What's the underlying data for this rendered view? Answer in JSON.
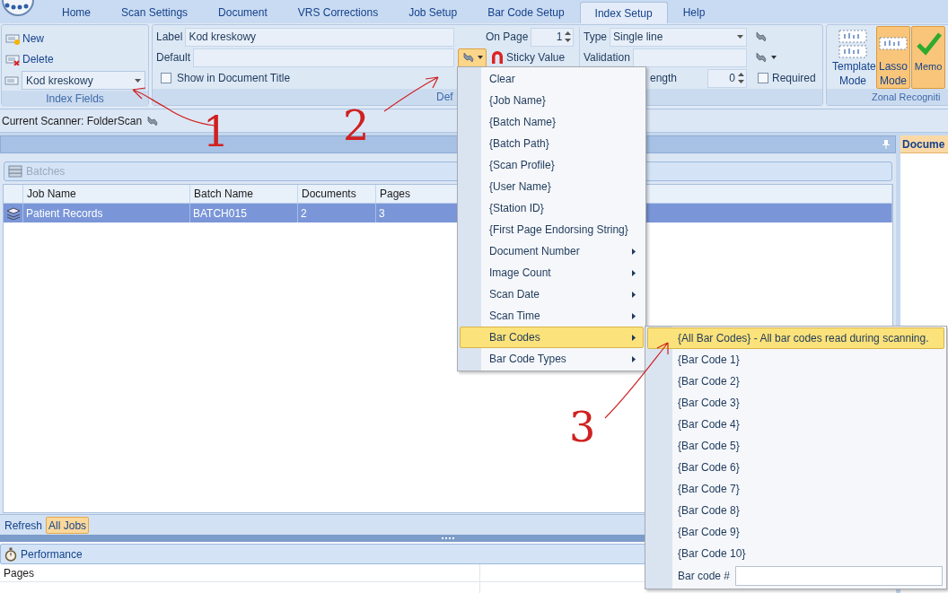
{
  "tabs": [
    {
      "label": "Home",
      "selected": false
    },
    {
      "label": "Scan Settings",
      "selected": false
    },
    {
      "label": "Document",
      "selected": false
    },
    {
      "label": "VRS Corrections",
      "selected": false
    },
    {
      "label": "Job Setup",
      "selected": false
    },
    {
      "label": "Bar Code Setup",
      "selected": false
    },
    {
      "label": "Index Setup",
      "selected": true
    },
    {
      "label": "Help",
      "selected": false
    }
  ],
  "index_fields": {
    "buttons": [
      "New",
      "Delete"
    ],
    "field_select": "Kod kreskowy",
    "group_label": "Index Fields"
  },
  "definition": {
    "label_caption": "Label",
    "label_value": "Kod kreskowy",
    "default_caption": "Default",
    "show_in_title": {
      "label": "Show in Document Title",
      "checked": false
    },
    "insert_button": {
      "expanded": true
    },
    "on_page_caption": "On Page",
    "on_page_value": "1",
    "sticky_value": "Sticky Value",
    "type_caption": "Type",
    "type_value": "Single line",
    "validation_caption": "Validation",
    "length_caption": "ength",
    "length_value": "0",
    "required": {
      "label": "Required",
      "checked": false
    },
    "group_label": "Def"
  },
  "zonal": {
    "buttons": [
      {
        "label": "Template Mode",
        "selected": false
      },
      {
        "label": "Lasso Mode",
        "selected": true
      },
      {
        "label": "Memo",
        "selected": true
      }
    ],
    "group_label": "Zonal Recogniti"
  },
  "scanner": "Current Scanner: FolderScan",
  "batches": {
    "title": "Batches",
    "columns": [
      "Job Name",
      "Batch Name",
      "Documents",
      "Pages"
    ],
    "rows": [
      {
        "cells": [
          "Patient Records",
          "BATCH015",
          "2",
          "3"
        ],
        "selected": true
      }
    ]
  },
  "bottom_buttons": [
    {
      "label": "Refresh",
      "selected": false
    },
    {
      "label": "All Jobs",
      "selected": true
    }
  ],
  "performance": {
    "title": "Performance",
    "rows": [
      "Pages"
    ]
  },
  "right_panel": {
    "title": "Docume"
  },
  "menu": [
    {
      "label": "Clear",
      "submenu": false,
      "selected": false
    },
    {
      "label": "{Job Name}",
      "submenu": false,
      "selected": false
    },
    {
      "label": "{Batch Name}",
      "submenu": false,
      "selected": false
    },
    {
      "label": "{Batch Path}",
      "submenu": false,
      "selected": false
    },
    {
      "label": "{Scan Profile}",
      "submenu": false,
      "selected": false
    },
    {
      "label": "{User Name}",
      "submenu": false,
      "selected": false
    },
    {
      "label": "{Station ID}",
      "submenu": false,
      "selected": false
    },
    {
      "label": "{First Page Endorsing String}",
      "submenu": false,
      "selected": false
    },
    {
      "label": "Document Number",
      "submenu": true,
      "selected": false
    },
    {
      "label": "Image Count",
      "submenu": true,
      "selected": false
    },
    {
      "label": "Scan Date",
      "submenu": true,
      "selected": false
    },
    {
      "label": "Scan Time",
      "submenu": true,
      "selected": false
    },
    {
      "label": "Bar Codes",
      "submenu": true,
      "selected": true
    },
    {
      "label": "Bar Code Types",
      "submenu": true,
      "selected": false
    }
  ],
  "submenu": {
    "items": [
      {
        "label": "{All Bar Codes} - All bar codes read during scanning.",
        "selected": true
      },
      {
        "label": "{Bar Code 1}",
        "selected": false
      },
      {
        "label": "{Bar Code 2}",
        "selected": false
      },
      {
        "label": "{Bar Code 3}",
        "selected": false
      },
      {
        "label": "{Bar Code 4}",
        "selected": false
      },
      {
        "label": "{Bar Code 5}",
        "selected": false
      },
      {
        "label": "{Bar Code 6}",
        "selected": false
      },
      {
        "label": "{Bar Code 7}",
        "selected": false
      },
      {
        "label": "{Bar Code 8}",
        "selected": false
      },
      {
        "label": "{Bar Code 9}",
        "selected": false
      },
      {
        "label": "{Bar Code 10}",
        "selected": false
      }
    ],
    "field_label": "Bar code #"
  },
  "annotations": [
    "1",
    "2",
    "3"
  ]
}
